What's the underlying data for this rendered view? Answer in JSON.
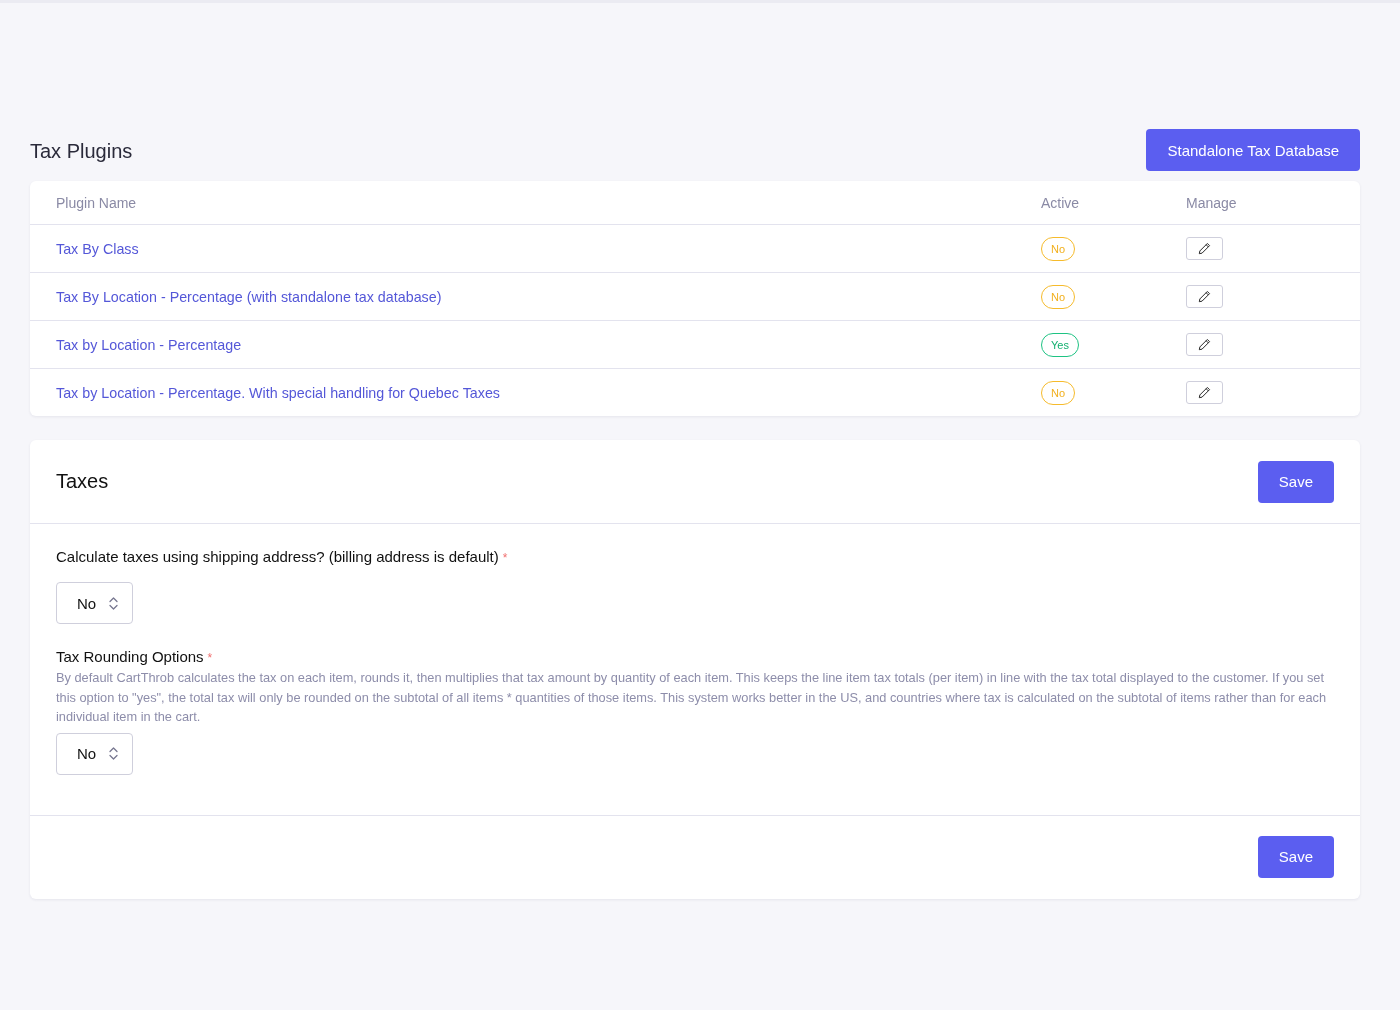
{
  "plugins": {
    "title": "Tax Plugins",
    "action_button": "Standalone Tax Database",
    "table": {
      "columns": [
        "Plugin Name",
        "Active",
        "Manage"
      ],
      "rows": [
        {
          "name": "Tax By Class",
          "active": false,
          "active_label": "No"
        },
        {
          "name": "Tax By Location - Percentage (with standalone tax database)",
          "active": false,
          "active_label": "No"
        },
        {
          "name": "Tax by Location - Percentage",
          "active": true,
          "active_label": "Yes"
        },
        {
          "name": "Tax by Location - Percentage. With special handling for Quebec Taxes",
          "active": false,
          "active_label": "No"
        }
      ]
    }
  },
  "taxes": {
    "title": "Taxes",
    "save_button_top": "Save",
    "fields": [
      {
        "label": "Calculate taxes using shipping address? (billing address is default)",
        "required_mark": "*",
        "value": "No"
      },
      {
        "label": "Tax Rounding Options",
        "required_mark": "*",
        "description": "By default CartThrob calculates the tax on each item, rounds it, then multiplies that tax amount by quantity of each item. This keeps the line item tax totals (per item) in line with the tax total displayed to the customer. If you set this option to \"yes\", the total tax will only be rounded on the subtotal of all items * quantities of those items. This system works better in the US, and countries where tax is calculated on the subtotal of items rather than for each individual item in the cart.",
        "value": "No"
      }
    ],
    "save_button_bottom": "Save"
  }
}
